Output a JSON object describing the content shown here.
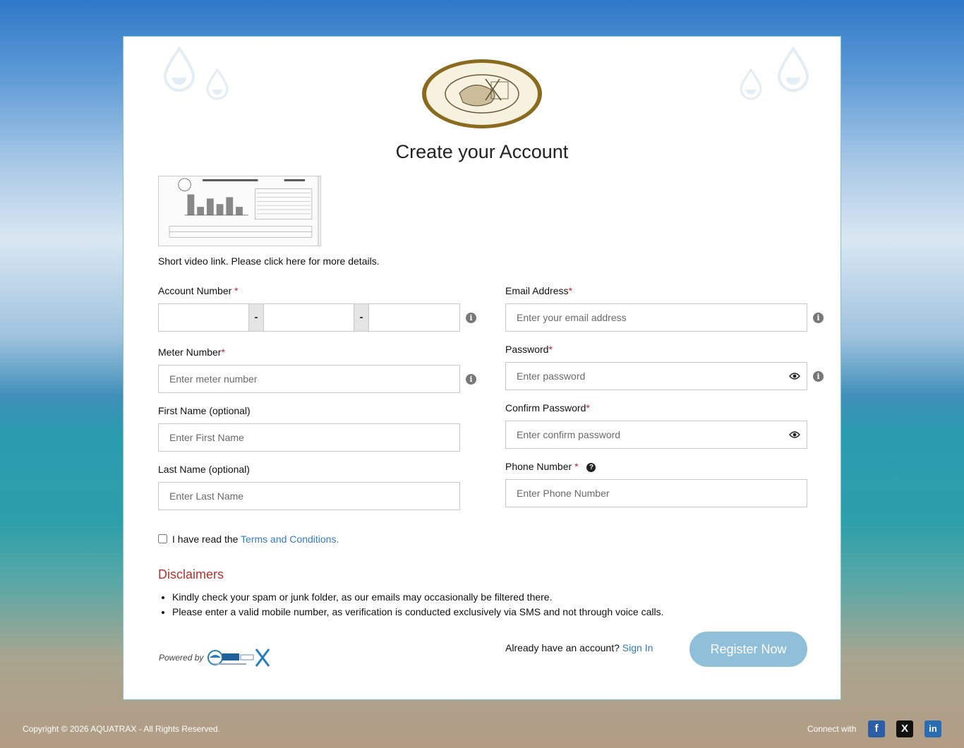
{
  "page": {
    "title": "Create your Account",
    "video_link_text": "Short video link. Please click here for more details."
  },
  "form": {
    "account_number": {
      "label": "Account Number",
      "required_mark": "*",
      "separator": "-"
    },
    "meter_number": {
      "label": "Meter Number",
      "required_mark": "*",
      "placeholder": "Enter meter number"
    },
    "first_name": {
      "label": "First Name (optional)",
      "placeholder": "Enter First Name"
    },
    "last_name": {
      "label": "Last Name (optional)",
      "placeholder": "Enter Last Name"
    },
    "email": {
      "label": "Email Address",
      "required_mark": "*",
      "placeholder": "Enter your email address"
    },
    "password": {
      "label": "Password",
      "required_mark": "*",
      "placeholder": "Enter password"
    },
    "confirm_password": {
      "label": "Confirm Password",
      "required_mark": "*",
      "placeholder": "Enter confirm password"
    },
    "phone": {
      "label": "Phone Number",
      "required_mark": "*",
      "placeholder": "Enter Phone Number"
    },
    "terms_prefix": "I have read the",
    "terms_link": "Terms and Conditions."
  },
  "disclaimers": {
    "title": "Disclaimers",
    "items": [
      "Kindly check your spam or junk folder, as our emails may occasionally be filtered there.",
      "Please enter a valid mobile number, as verification is conducted exclusively via SMS and not through voice calls."
    ]
  },
  "footer_card": {
    "powered_by": "Powered by",
    "have_account": "Already have an account?",
    "sign_in": "Sign In",
    "register_button": "Register Now"
  },
  "footer": {
    "copyright": "Copyright © 2026 AQUATRAX - All Rights Reserved.",
    "connect_with": "Connect with",
    "social": [
      {
        "name": "facebook-icon",
        "glyph": "f",
        "color": "#2c5ea8"
      },
      {
        "name": "x-icon",
        "glyph": "X",
        "color": "#111111"
      },
      {
        "name": "linkedin-icon",
        "glyph": "in",
        "color": "#2a6cb3"
      }
    ]
  },
  "colors": {
    "accent": "#2e7cc7",
    "register_button": "#8fbfd9",
    "required": "#c0202a",
    "disclaimer_title": "#b9302c"
  }
}
